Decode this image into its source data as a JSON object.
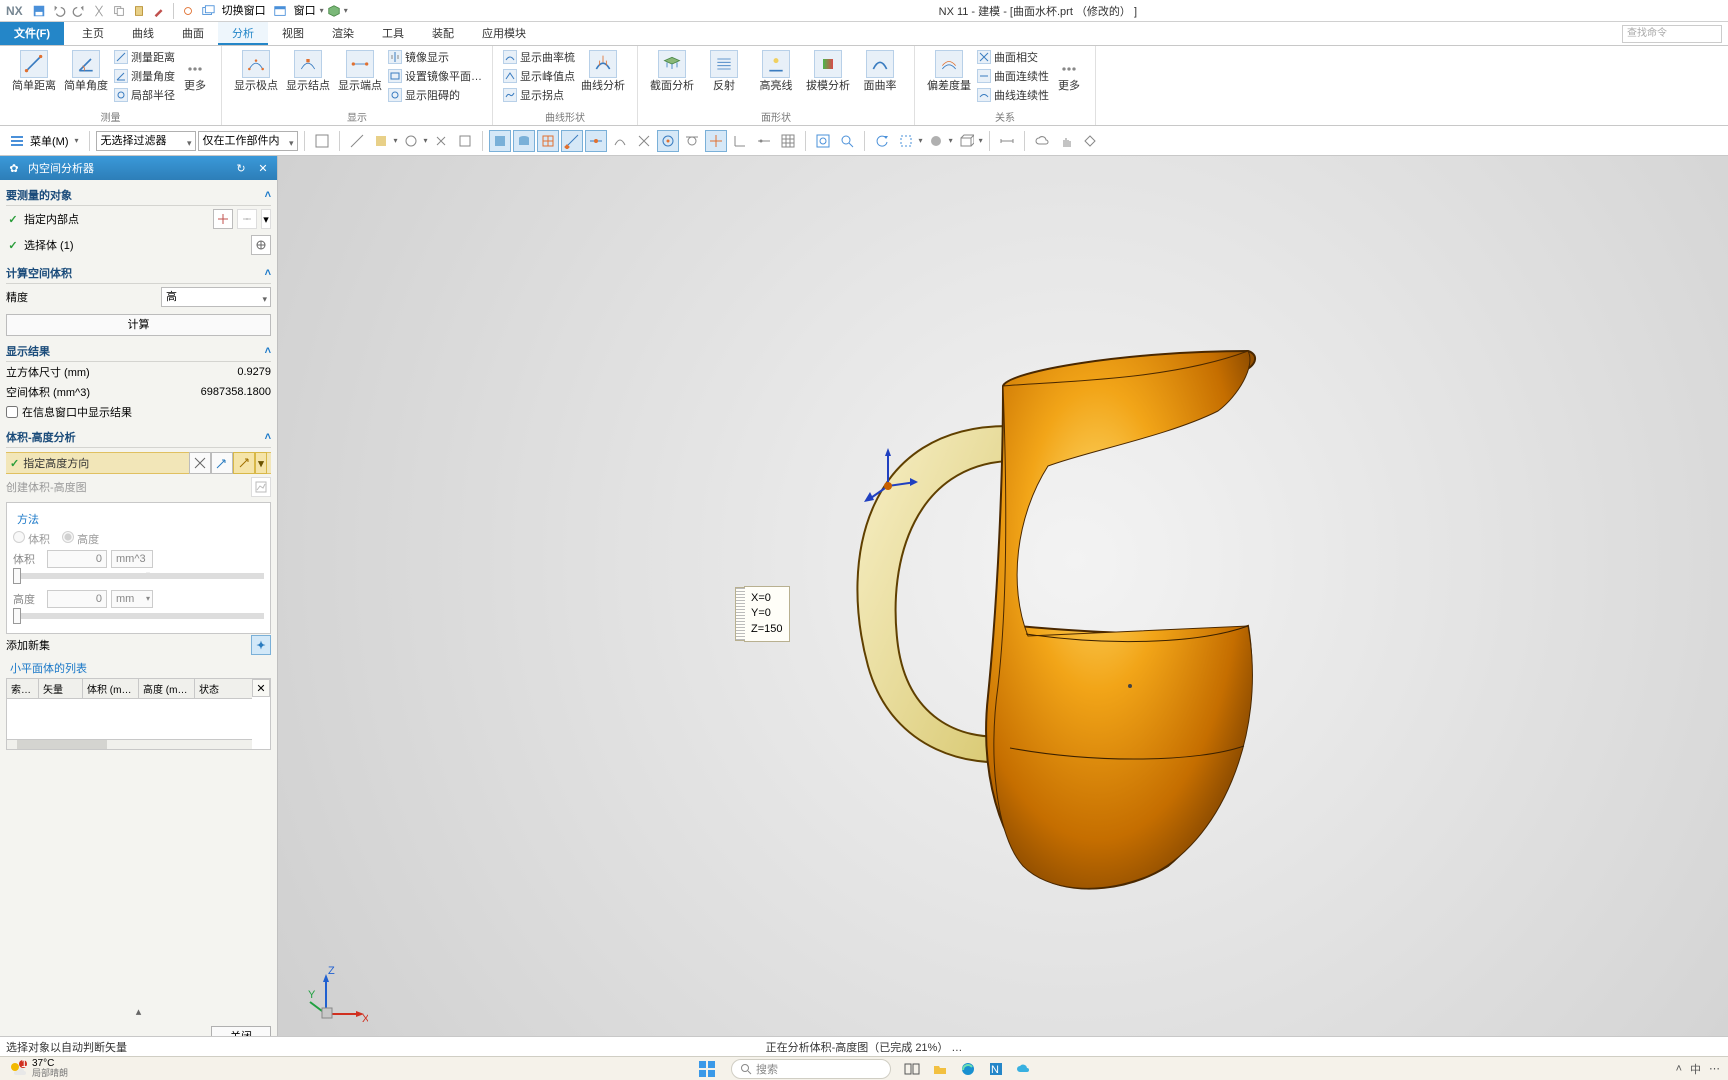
{
  "app": {
    "logo": "NX",
    "title": "NX 11 - 建模 - [曲面水杯.prt （修改的） ]",
    "searchPlaceholder": "查找命令"
  },
  "qat": {
    "items": [
      "save",
      "undo",
      "redo",
      "cut",
      "copy",
      "paste",
      "brush",
      "dropper",
      "switchwin",
      "window",
      "cube"
    ],
    "switchLabel": "切换窗口",
    "windowLabel": "窗口"
  },
  "tabs": {
    "file": "文件(F)",
    "items": [
      "主页",
      "曲线",
      "曲面",
      "分析",
      "视图",
      "渲染",
      "工具",
      "装配",
      "应用模块"
    ],
    "activeIndex": 3
  },
  "ribbon": {
    "groups": [
      {
        "label": "测量",
        "big": [
          {
            "name": "简单距离",
            "icon": "measure-dist"
          },
          {
            "name": "简单角度",
            "icon": "measure-ang"
          }
        ],
        "small": [
          "测量距离",
          "测量角度",
          "局部半径"
        ],
        "more": "更多"
      },
      {
        "label": "显示",
        "big": [
          {
            "name": "显示极点",
            "icon": "poles"
          },
          {
            "name": "显示结点",
            "icon": "knots"
          },
          {
            "name": "显示端点",
            "icon": "endpt"
          }
        ],
        "small": [
          "镜像显示",
          "设置镜像平面…",
          "显示阻碍的"
        ]
      },
      {
        "label": "曲线形状",
        "big": [
          {
            "name": "曲线分析",
            "icon": "curve-an"
          }
        ],
        "small": [
          "显示曲率梳",
          "显示峰值点",
          "显示拐点"
        ]
      },
      {
        "label": "面形状",
        "big": [
          {
            "name": "截面分析",
            "icon": "sec"
          },
          {
            "name": "反射",
            "icon": "refl"
          },
          {
            "name": "高亮线",
            "icon": "hl"
          },
          {
            "name": "拔模分析",
            "icon": "draft"
          },
          {
            "name": "面曲率",
            "icon": "curv"
          }
        ]
      },
      {
        "label": "关系",
        "big": [
          {
            "name": "偏差度量",
            "icon": "dev"
          }
        ],
        "small": [
          "曲面相交",
          "曲面连续性",
          "曲线连续性"
        ],
        "more": "更多"
      }
    ]
  },
  "toolbar": {
    "menuBtn": "菜单(M)",
    "filter1": "无选择过滤器",
    "filter2": "仅在工作部件内"
  },
  "dialog": {
    "title": "内空间分析器",
    "sect_objects": "要测量的对象",
    "specify_inner": "指定内部点",
    "select_body": "选择体 (1)",
    "sect_calc": "计算空间体积",
    "precision_lbl": "精度",
    "precision_val": "高",
    "calc_btn": "计算",
    "sect_results": "显示结果",
    "cube_size_lbl": "立方体尺寸 (mm)",
    "cube_size_val": "0.9279",
    "volume_lbl": "空间体积 (mm^3)",
    "volume_val": "6987358.1800",
    "show_in_info": "在信息窗口中显示结果",
    "sect_height": "体积-高度分析",
    "specify_dir": "指定高度方向",
    "create_plot": "创建体积-高度图",
    "method_lbl": "方法",
    "radio_vol": "体积",
    "radio_height": "高度",
    "vol_lbl": "体积",
    "vol_val": "0",
    "vol_unit": "mm^3",
    "height_lbl": "高度",
    "height_val": "0",
    "height_unit": "mm",
    "add_new": "添加新集",
    "smallface_list": "小平面体的列表",
    "cols": [
      "索…",
      "矢量",
      "体积 (m…",
      "高度 (m…",
      "状态"
    ],
    "close": "关闭"
  },
  "viewport": {
    "coords": {
      "x": "X=0",
      "y": "Y=0",
      "z": "Z=150"
    },
    "wcs": {
      "x": "X",
      "y": "Y",
      "z": "Z"
    }
  },
  "status": {
    "left": "选择对象以自动判断矢量",
    "center": "正在分析体积-高度图（已完成 21%）  …"
  },
  "taskbar": {
    "temp": "37°C",
    "weather": "局部晴朗",
    "search": "搜索"
  }
}
